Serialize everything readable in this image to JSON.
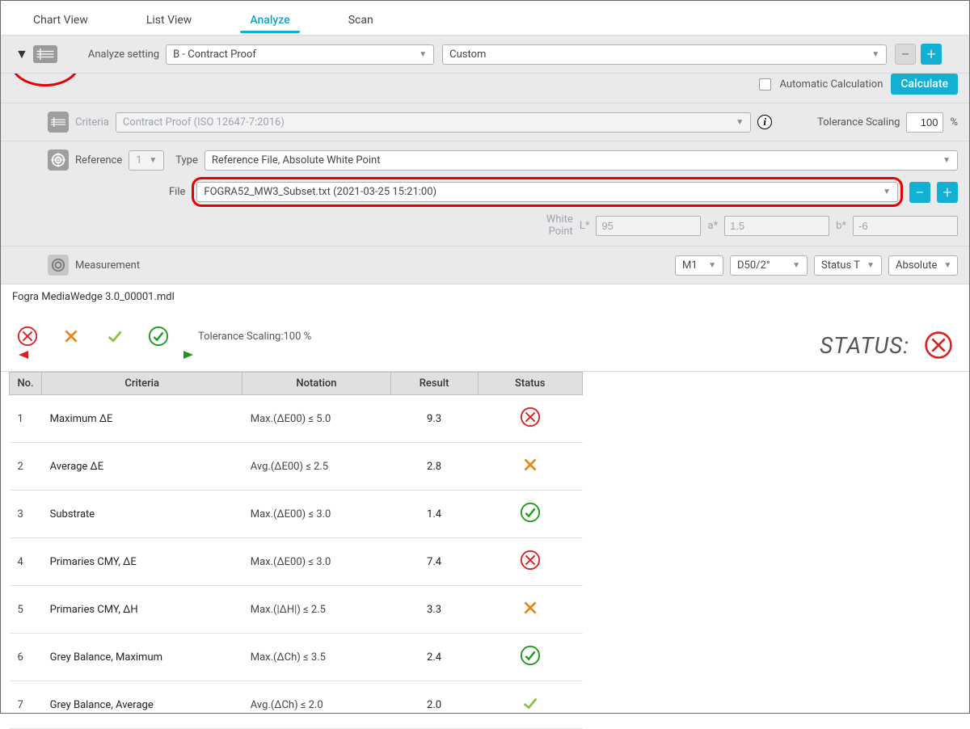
{
  "tabs": {
    "chart_view": "Chart View",
    "list_view": "List View",
    "analyze": "Analyze",
    "scan": "Scan"
  },
  "analyze_setting_label": "Analyze setting",
  "analyze_setting_value": "B - Contract Proof",
  "analyze_preset_value": "Custom",
  "auto_calc_label": "Automatic Calculation",
  "calculate_label": "Calculate",
  "criteria_label": "Criteria",
  "criteria_value": "Contract Proof (ISO 12647-7:2016)",
  "tolerance_label": "Tolerance Scaling",
  "tolerance_value": "100",
  "tolerance_unit": "%",
  "reference_label": "Reference",
  "reference_index": "1",
  "type_label": "Type",
  "type_value": "Reference File, Absolute White Point",
  "file_label": "File",
  "file_value": "FOGRA52_MW3_Subset.txt  (2021-03-25  15:21:00)",
  "white_point_label": "White\nPoint",
  "wp_L_label": "L*",
  "wp_L_value": "95",
  "wp_a_label": "a*",
  "wp_a_value": "1.5",
  "wp_b_label": "b*",
  "wp_b_value": "-6",
  "measurement_label": "Measurement",
  "meas_mode": "M1",
  "meas_illum": "D50/2°",
  "meas_status": "Status T",
  "meas_abs": "Absolute",
  "file_title": "Fogra MediaWedge 3.0_00001.mdl",
  "tol_scaling_label": "Tolerance Scaling:100 %",
  "status_label": "STATUS:",
  "th_no": "No.",
  "th_criteria": "Criteria",
  "th_notation": "Notation",
  "th_result": "Result",
  "th_status": "Status",
  "rows": [
    {
      "no": "1",
      "criteria": "Maximum ΔE",
      "notation": "Max.(ΔE00)    ≤ 5.0",
      "result": "9.3",
      "status": "fail"
    },
    {
      "no": "2",
      "criteria": "Average ΔE",
      "notation": "Avg.(ΔE00)    ≤ 2.5",
      "result": "2.8",
      "status": "warn"
    },
    {
      "no": "3",
      "criteria": "Substrate",
      "notation": "Max.(ΔE00)    ≤ 3.0",
      "result": "1.4",
      "status": "pass"
    },
    {
      "no": "4",
      "criteria": "Primaries CMY, ΔE",
      "notation": "Max.(ΔE00)    ≤ 3.0",
      "result": "7.4",
      "status": "fail"
    },
    {
      "no": "5",
      "criteria": "Primaries CMY, ΔH",
      "notation": "Max.(|ΔH|)    ≤ 2.5",
      "result": "3.3",
      "status": "warn"
    },
    {
      "no": "6",
      "criteria": "Grey Balance, Maximum",
      "notation": "Max.(ΔCh)    ≤ 3.5",
      "result": "2.4",
      "status": "pass"
    },
    {
      "no": "7",
      "criteria": "Grey Balance, Average",
      "notation": "Avg.(ΔCh)     ≤ 2.0",
      "result": "2.0",
      "status": "passlight"
    }
  ]
}
